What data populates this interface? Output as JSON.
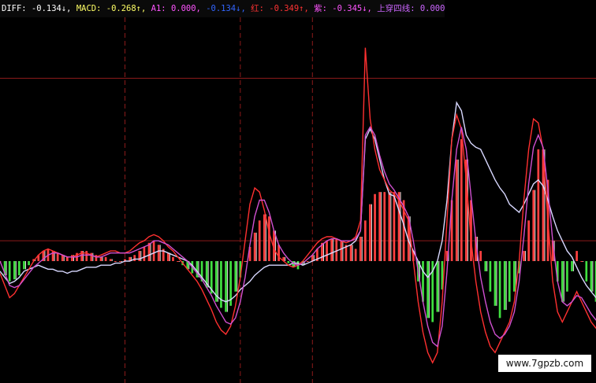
{
  "legend": {
    "items": [
      {
        "name": "DIFF",
        "value": "-0.134",
        "arrow": "↓",
        "color": "#ffffff"
      },
      {
        "name": "MACD",
        "value": "-0.268",
        "arrow": "↑",
        "color": "#ffff66"
      },
      {
        "name": "A1",
        "value": "0.000",
        "arrow": "",
        "color": "#ff55ff"
      },
      {
        "name": "",
        "value": "-0.134",
        "arrow": "↓",
        "color": "#3366ff"
      },
      {
        "name": "红",
        "value": "-0.349",
        "arrow": "↑",
        "color": "#ff3333"
      },
      {
        "name": "紫",
        "value": "-0.345",
        "arrow": "↓",
        "color": "#ff55ff"
      },
      {
        "name": "上穿四线",
        "value": "0.000",
        "arrow": "",
        "color": "#cc66ff"
      }
    ]
  },
  "watermark": "www.7gpzb.com",
  "colors": {
    "background": "#000000",
    "grid": "#8b1a1a",
    "bar_pos": "#ff4040",
    "bar_neg": "#40e040",
    "bar_white": "#ffffff",
    "diff_line": "#d8d8ff",
    "red_line": "#ff3030",
    "purple_line": "#d050d0"
  },
  "chart_data": {
    "type": "line",
    "x_count": 125,
    "ylim": [
      -0.6,
      1.2
    ],
    "zero_line": 0,
    "h_gridlines": [
      0.9,
      0.1
    ],
    "v_gridlines_at_x": [
      26,
      50,
      65
    ],
    "histogram": [
      0.0,
      -0.07,
      -0.1,
      -0.09,
      -0.07,
      -0.04,
      -0.02,
      0.01,
      0.03,
      0.05,
      0.06,
      0.05,
      0.04,
      0.03,
      0.02,
      0.03,
      0.04,
      0.05,
      0.05,
      0.04,
      0.03,
      0.02,
      0.02,
      0.01,
      0.0,
      0.0,
      0.01,
      0.02,
      0.03,
      0.05,
      0.07,
      0.09,
      0.1,
      0.08,
      0.06,
      0.04,
      0.02,
      0.0,
      -0.02,
      -0.04,
      -0.06,
      -0.08,
      -0.1,
      -0.13,
      -0.16,
      -0.2,
      -0.23,
      -0.25,
      -0.22,
      -0.15,
      -0.08,
      0.0,
      0.07,
      0.14,
      0.2,
      0.23,
      0.22,
      0.15,
      0.08,
      0.02,
      -0.01,
      -0.03,
      -0.04,
      -0.02,
      0.0,
      0.03,
      0.06,
      0.09,
      0.1,
      0.11,
      0.11,
      0.1,
      0.08,
      0.08,
      0.06,
      0.12,
      0.2,
      0.28,
      0.33,
      0.34,
      0.34,
      0.34,
      0.34,
      0.34,
      0.3,
      0.22,
      0.05,
      -0.1,
      -0.2,
      -0.28,
      -0.3,
      -0.25,
      -0.14,
      0.05,
      0.3,
      0.5,
      0.6,
      0.5,
      0.3,
      0.12,
      0.05,
      -0.05,
      -0.15,
      -0.22,
      -0.28,
      -0.24,
      -0.2,
      -0.15,
      -0.06,
      0.05,
      0.2,
      0.35,
      0.55,
      0.55,
      0.4,
      0.1,
      -0.1,
      -0.2,
      -0.15,
      -0.05,
      0.05,
      0.0,
      -0.1,
      -0.15,
      -0.2,
      -0.25,
      -0.2
    ],
    "series": [
      {
        "values": [
          -0.05,
          -0.08,
          -0.11,
          -0.1,
          -0.08,
          -0.05,
          -0.04,
          -0.03,
          -0.02,
          -0.03,
          -0.04,
          -0.04,
          -0.05,
          -0.05,
          -0.06,
          -0.05,
          -0.05,
          -0.04,
          -0.03,
          -0.03,
          -0.03,
          -0.02,
          -0.02,
          -0.02,
          -0.01,
          -0.01,
          0.0,
          0.0,
          0.01,
          0.01,
          0.02,
          0.03,
          0.04,
          0.05,
          0.05,
          0.04,
          0.03,
          0.02,
          0.01,
          0.0,
          -0.02,
          -0.05,
          -0.08,
          -0.11,
          -0.14,
          -0.17,
          -0.19,
          -0.2,
          -0.19,
          -0.17,
          -0.14,
          -0.12,
          -0.1,
          -0.07,
          -0.05,
          -0.03,
          -0.02,
          -0.02,
          -0.02,
          -0.02,
          -0.02,
          -0.01,
          -0.01,
          -0.02,
          -0.01,
          0.0,
          0.01,
          0.02,
          0.03,
          0.04,
          0.05,
          0.06,
          0.07,
          0.08,
          0.1,
          0.15,
          0.6,
          0.65,
          0.6,
          0.5,
          0.4,
          0.33,
          0.32,
          0.25,
          0.18,
          0.1,
          0.05,
          0.0,
          -0.05,
          -0.08,
          -0.05,
          0.0,
          0.1,
          0.3,
          0.6,
          0.78,
          0.74,
          0.62,
          0.58,
          0.56,
          0.55,
          0.5,
          0.45,
          0.4,
          0.36,
          0.33,
          0.28,
          0.26,
          0.24,
          0.28,
          0.33,
          0.38,
          0.4,
          0.37,
          0.3,
          0.22,
          0.15,
          0.1,
          0.05,
          0.02,
          -0.03,
          -0.08,
          -0.12,
          -0.15,
          -0.18
        ]
      },
      {
        "values": [
          -0.06,
          -0.12,
          -0.18,
          -0.16,
          -0.12,
          -0.08,
          -0.04,
          0.0,
          0.03,
          0.05,
          0.06,
          0.05,
          0.04,
          0.03,
          0.02,
          0.02,
          0.03,
          0.04,
          0.04,
          0.03,
          0.02,
          0.03,
          0.04,
          0.05,
          0.05,
          0.04,
          0.04,
          0.05,
          0.07,
          0.09,
          0.1,
          0.12,
          0.13,
          0.12,
          0.1,
          0.07,
          0.05,
          0.02,
          -0.01,
          -0.04,
          -0.07,
          -0.1,
          -0.14,
          -0.19,
          -0.24,
          -0.3,
          -0.34,
          -0.36,
          -0.32,
          -0.22,
          -0.08,
          0.1,
          0.28,
          0.36,
          0.34,
          0.25,
          0.14,
          0.06,
          0.02,
          0.0,
          -0.02,
          -0.03,
          -0.02,
          0.0,
          0.03,
          0.06,
          0.09,
          0.11,
          0.12,
          0.12,
          0.11,
          0.1,
          0.09,
          0.1,
          0.12,
          0.2,
          1.05,
          0.7,
          0.55,
          0.45,
          0.4,
          0.35,
          0.33,
          0.3,
          0.25,
          0.2,
          0.0,
          -0.2,
          -0.35,
          -0.45,
          -0.5,
          -0.45,
          -0.2,
          0.2,
          0.6,
          0.72,
          0.65,
          0.4,
          0.1,
          -0.1,
          -0.25,
          -0.35,
          -0.42,
          -0.45,
          -0.4,
          -0.35,
          -0.3,
          -0.2,
          0.0,
          0.3,
          0.55,
          0.7,
          0.68,
          0.55,
          0.2,
          -0.1,
          -0.25,
          -0.3,
          -0.25,
          -0.2,
          -0.15,
          -0.2,
          -0.25,
          -0.3,
          -0.33,
          -0.34,
          -0.35
        ]
      },
      {
        "values": [
          0.0,
          -0.06,
          -0.12,
          -0.13,
          -0.12,
          -0.09,
          -0.06,
          -0.03,
          -0.01,
          0.01,
          0.03,
          0.04,
          0.04,
          0.03,
          0.02,
          0.02,
          0.02,
          0.03,
          0.03,
          0.03,
          0.02,
          0.02,
          0.03,
          0.04,
          0.04,
          0.04,
          0.04,
          0.04,
          0.05,
          0.06,
          0.07,
          0.08,
          0.1,
          0.1,
          0.09,
          0.08,
          0.06,
          0.04,
          0.02,
          0.0,
          -0.03,
          -0.06,
          -0.09,
          -0.13,
          -0.17,
          -0.22,
          -0.26,
          -0.3,
          -0.31,
          -0.28,
          -0.2,
          -0.08,
          0.08,
          0.22,
          0.3,
          0.3,
          0.24,
          0.15,
          0.08,
          0.04,
          0.01,
          -0.01,
          -0.02,
          -0.01,
          0.01,
          0.03,
          0.06,
          0.08,
          0.1,
          0.11,
          0.11,
          0.1,
          0.1,
          0.1,
          0.11,
          0.15,
          0.62,
          0.66,
          0.62,
          0.52,
          0.44,
          0.38,
          0.35,
          0.31,
          0.27,
          0.22,
          0.1,
          -0.05,
          -0.2,
          -0.32,
          -0.4,
          -0.42,
          -0.32,
          -0.05,
          0.3,
          0.55,
          0.66,
          0.55,
          0.32,
          0.1,
          -0.08,
          -0.2,
          -0.3,
          -0.36,
          -0.38,
          -0.36,
          -0.32,
          -0.25,
          -0.1,
          0.12,
          0.38,
          0.56,
          0.62,
          0.56,
          0.35,
          0.1,
          -0.1,
          -0.2,
          -0.22,
          -0.2,
          -0.17,
          -0.18,
          -0.22,
          -0.26,
          -0.29,
          -0.31,
          -0.32
        ]
      }
    ]
  }
}
